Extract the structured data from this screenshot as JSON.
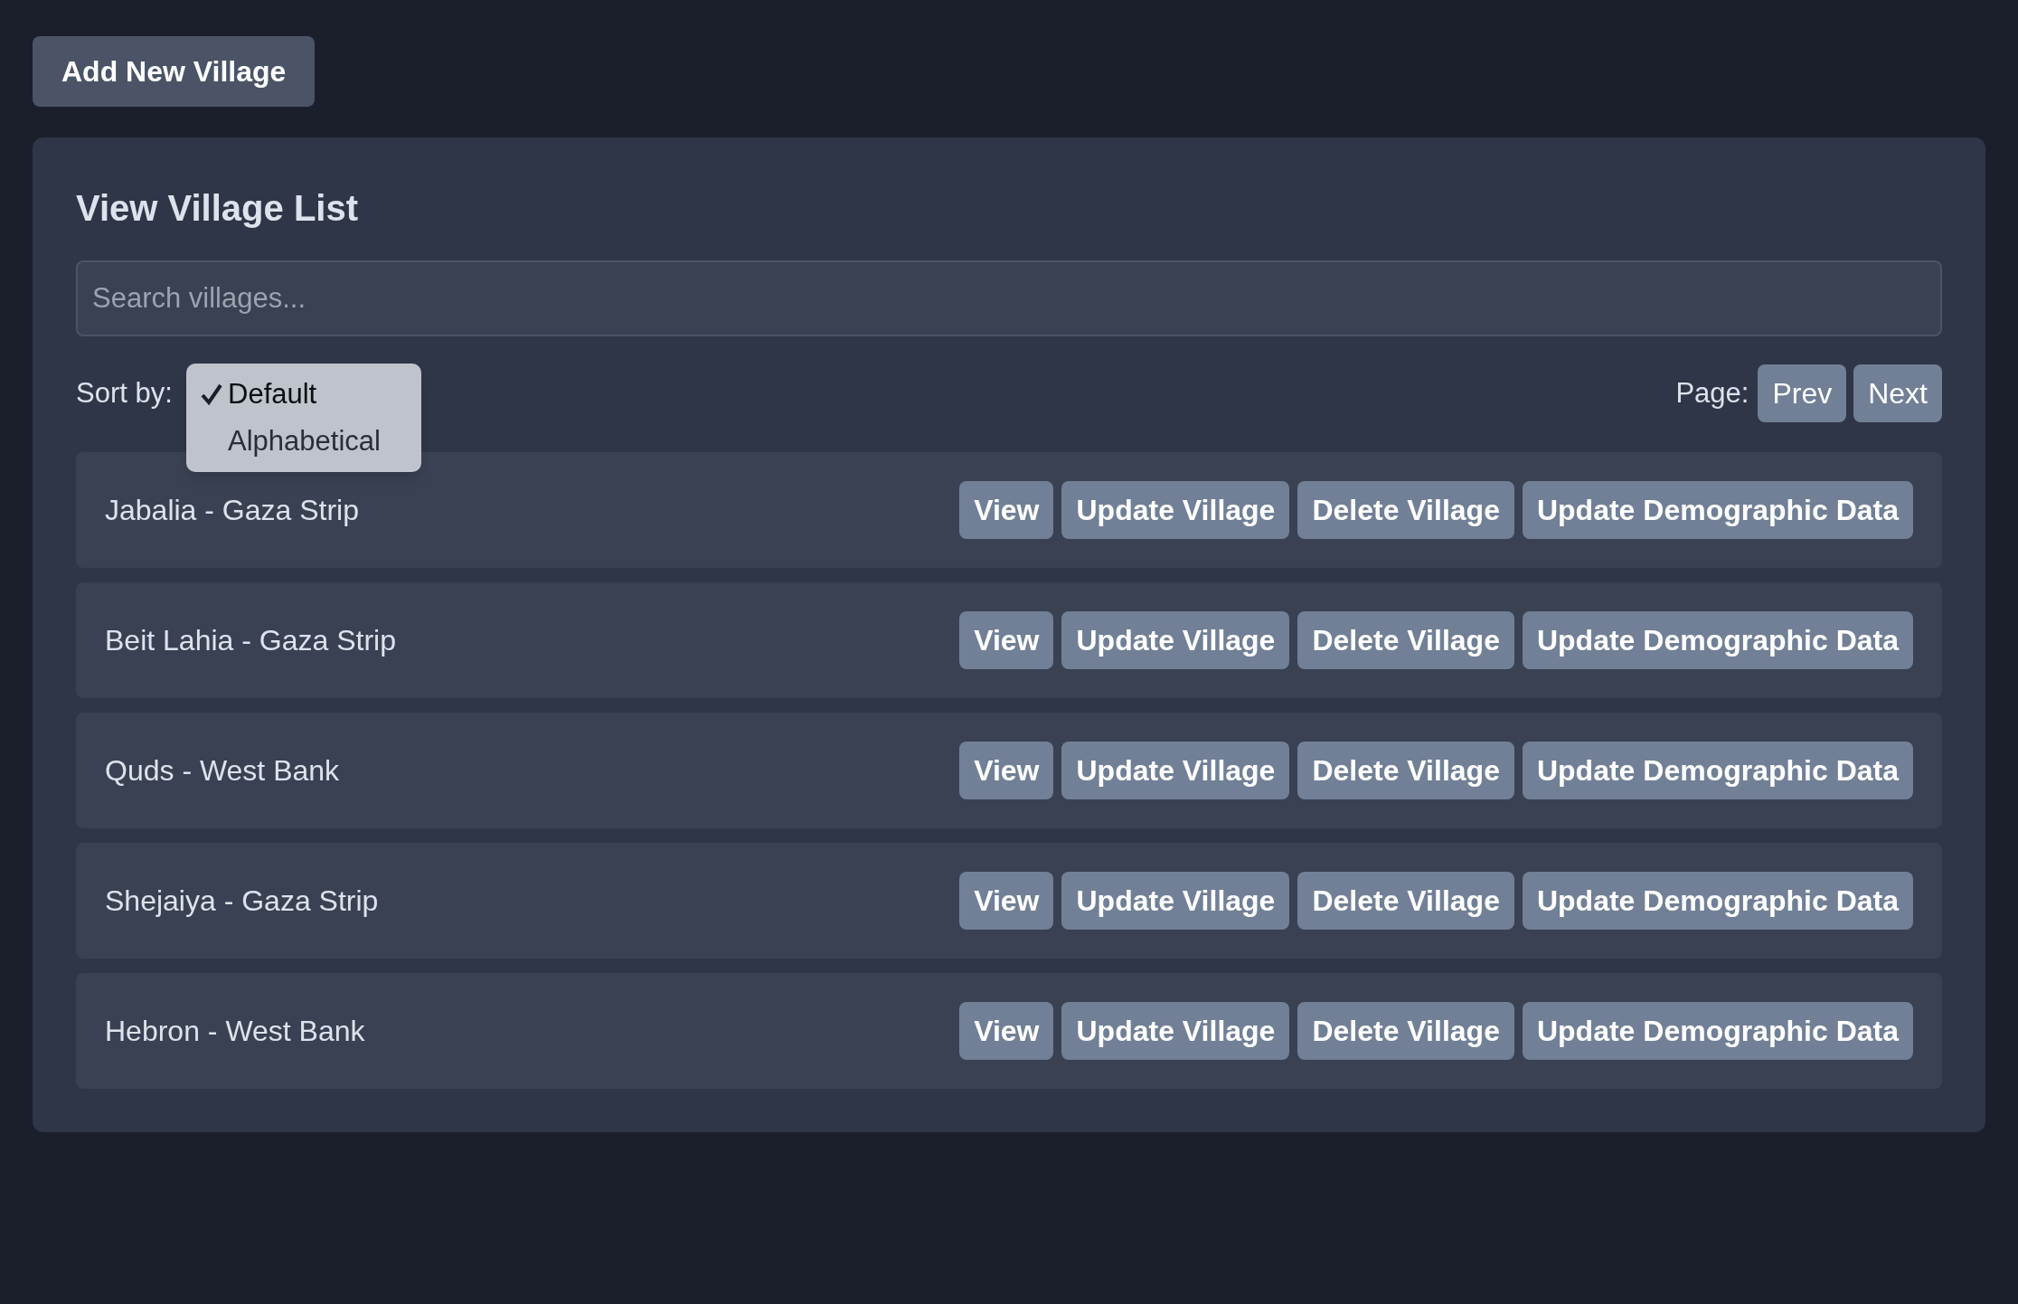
{
  "add_button": "Add New Village",
  "panel": {
    "title": "View Village List",
    "search": {
      "placeholder": "Search villages..."
    },
    "sort": {
      "label": "Sort by:",
      "options": [
        {
          "label": "Default",
          "selected": true
        },
        {
          "label": "Alphabetical",
          "selected": false
        }
      ]
    },
    "pagination": {
      "label": "Page:",
      "buttons": [
        "Prev",
        "Next"
      ]
    },
    "villages": [
      {
        "name": "Jabalia - Gaza Strip",
        "actions": [
          "View",
          "Update Village",
          "Delete Village",
          "Update Demographic Data"
        ]
      },
      {
        "name": "Beit Lahia - Gaza Strip",
        "actions": [
          "View",
          "Update Village",
          "Delete Village",
          "Update Demographic Data"
        ]
      },
      {
        "name": "Quds - West Bank",
        "actions": [
          "View",
          "Update Village",
          "Delete Village",
          "Update Demographic Data"
        ]
      },
      {
        "name": "Shejaiya - Gaza Strip",
        "actions": [
          "View",
          "Update Village",
          "Delete Village",
          "Update Demographic Data"
        ]
      },
      {
        "name": "Hebron - West Bank",
        "actions": [
          "View",
          "Update Village",
          "Delete Village",
          "Update Demographic Data"
        ]
      }
    ]
  }
}
